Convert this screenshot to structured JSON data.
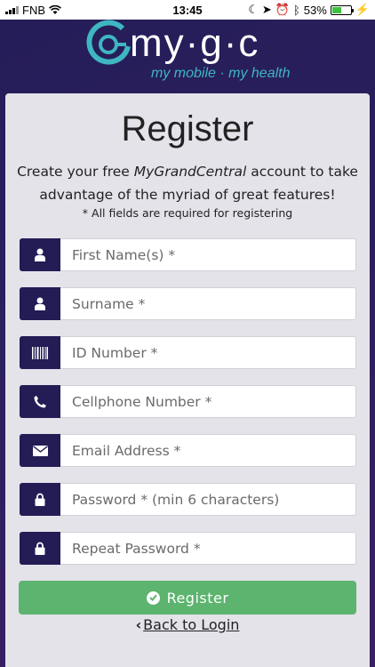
{
  "status_bar": {
    "carrier": "FNB",
    "time": "13:45",
    "battery": "53%",
    "battery_level": 0.53
  },
  "logo": {
    "wordmark": "my·g·c",
    "tagline": "my mobile · my health",
    "accent_color": "#3fb6c1"
  },
  "form": {
    "title": "Register",
    "intro_before": "Create your free ",
    "intro_brand": "MyGrandCentral",
    "intro_after": " account to take advantage of the myriad of great features!",
    "required_note": "* All fields are required for registering",
    "fields": [
      {
        "icon": "user-icon",
        "placeholder": "First Name(s) *"
      },
      {
        "icon": "user-icon",
        "placeholder": "Surname *"
      },
      {
        "icon": "barcode-icon",
        "placeholder": "ID Number *"
      },
      {
        "icon": "phone-icon",
        "placeholder": "Cellphone Number *"
      },
      {
        "icon": "envelope-icon",
        "placeholder": "Email Address *"
      },
      {
        "icon": "lock-icon",
        "placeholder": "Password * (min 6 characters)"
      },
      {
        "icon": "lock-icon",
        "placeholder": "Repeat Password *"
      }
    ],
    "submit_label": "Register",
    "back_label": "Back to Login",
    "icon_bg_color": "#231c55",
    "submit_color": "#5cb46e"
  }
}
